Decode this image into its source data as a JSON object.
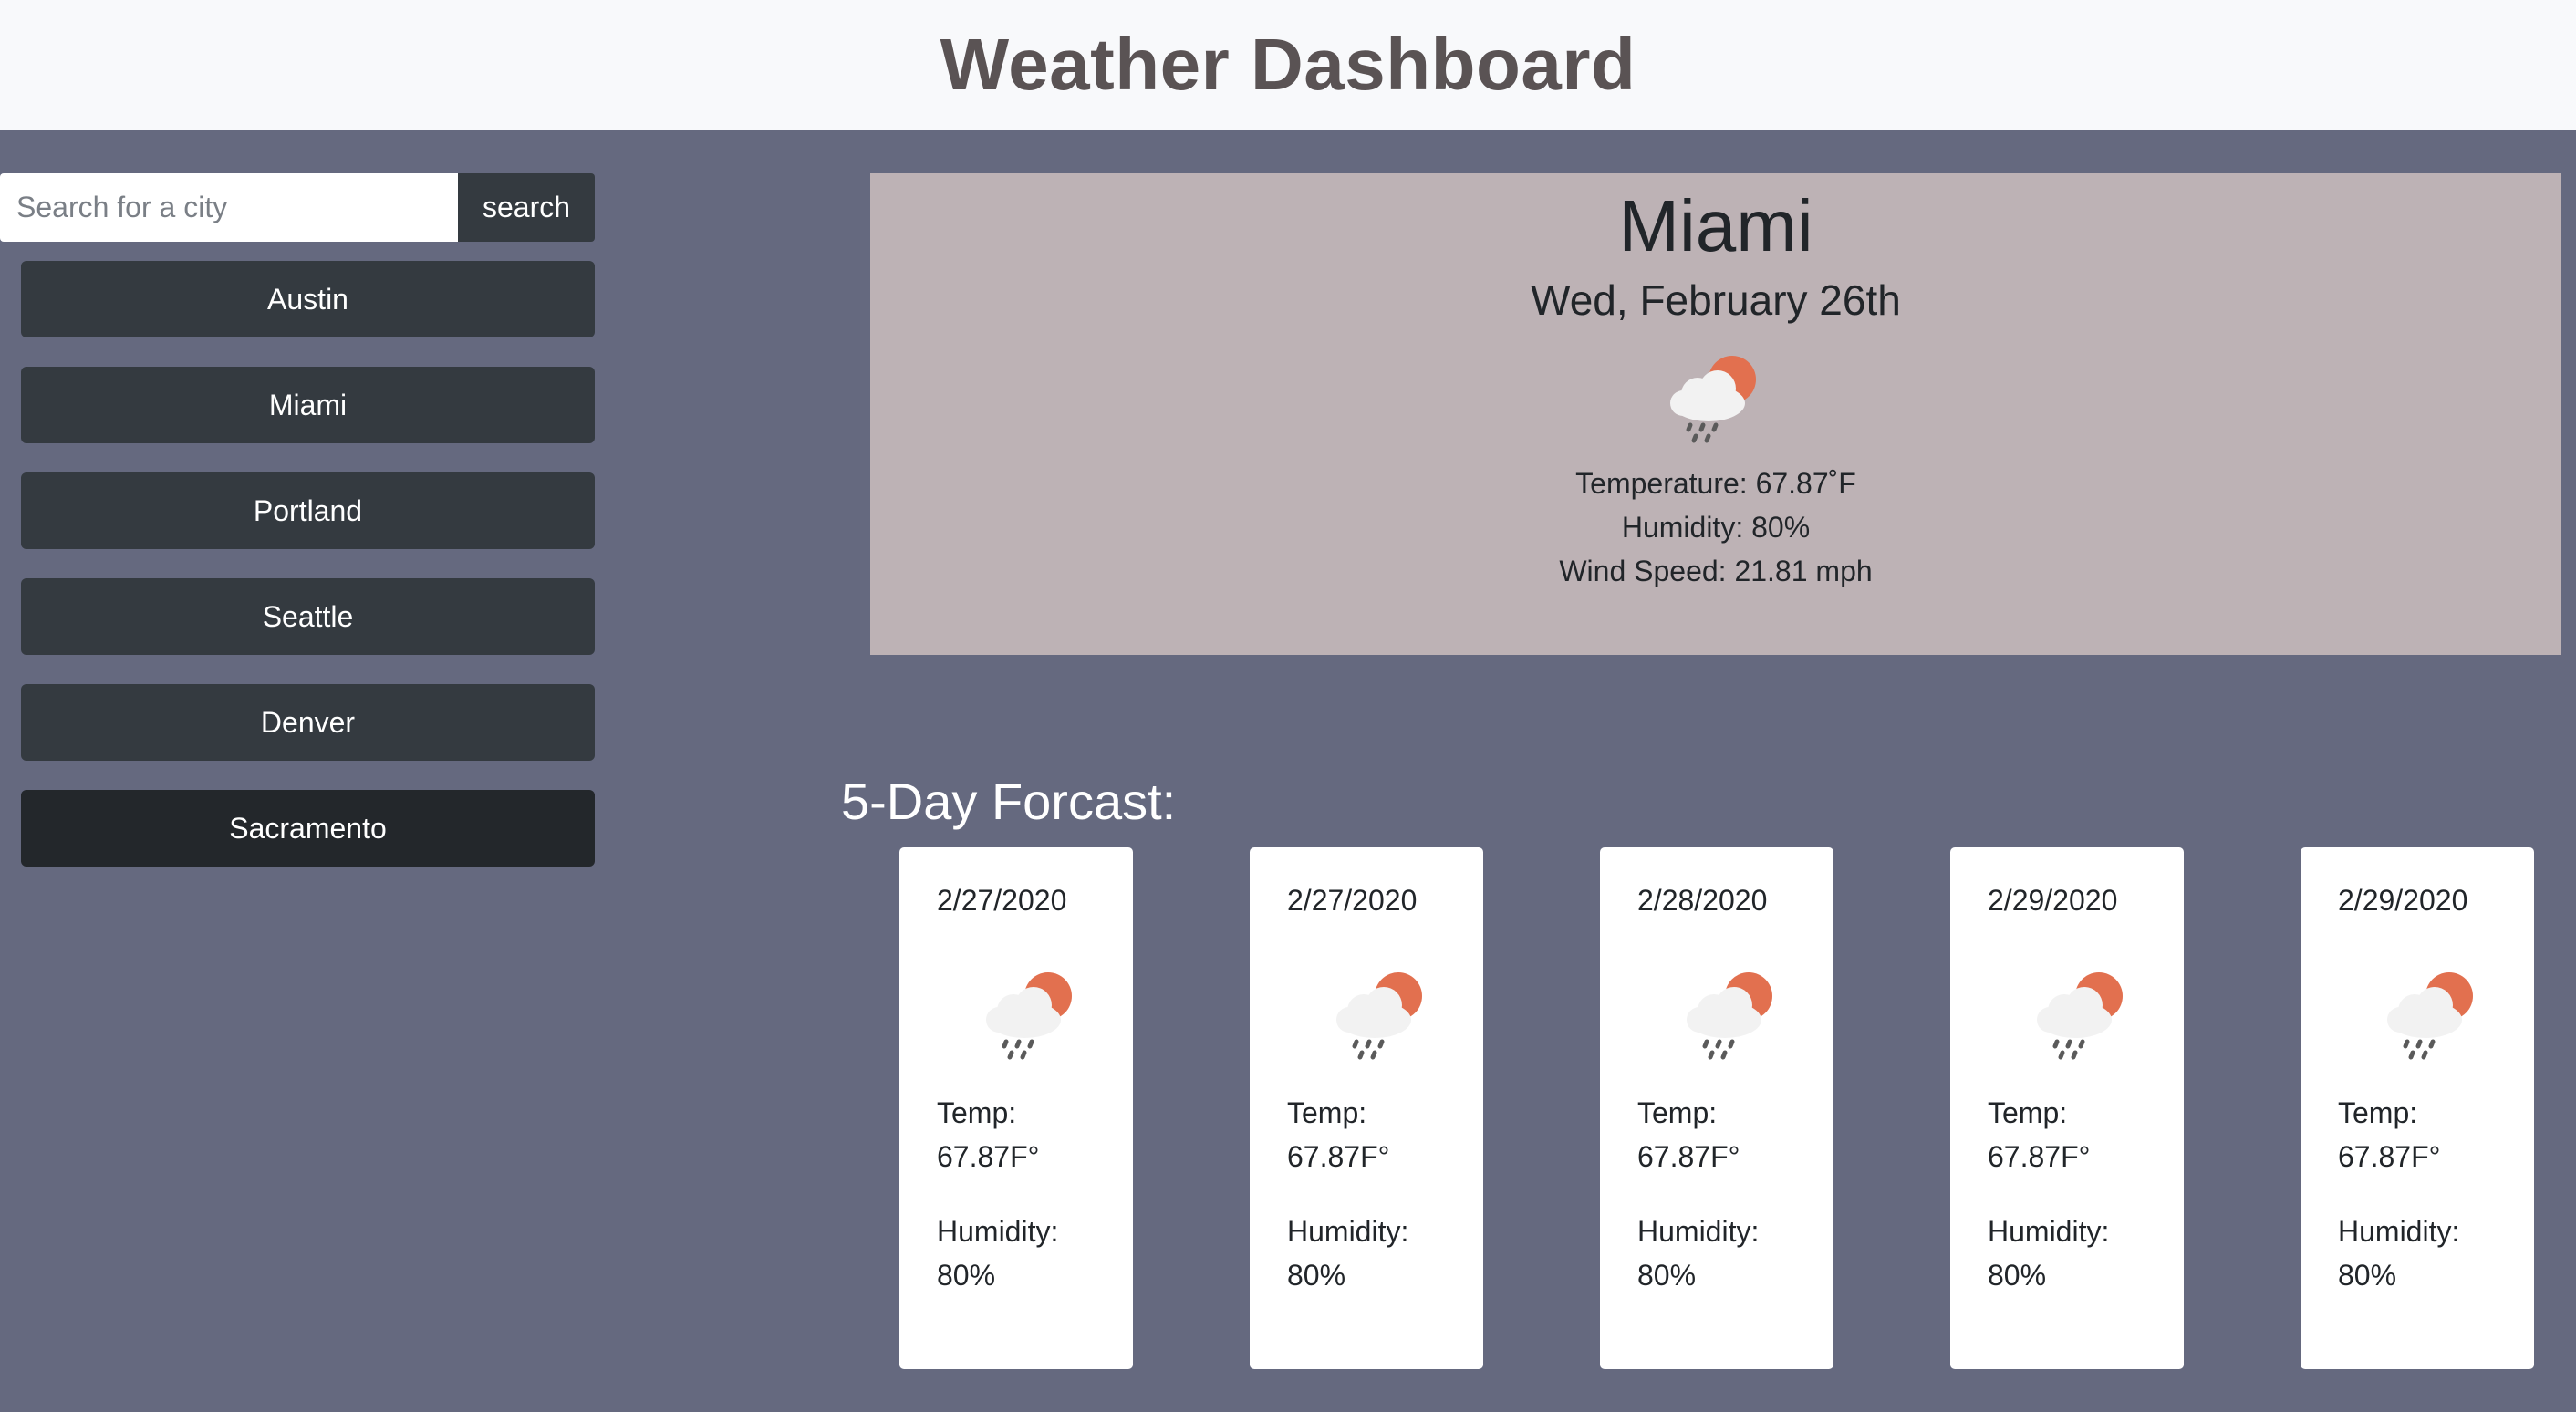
{
  "header": {
    "title": "Weather Dashboard"
  },
  "search": {
    "placeholder": "Search for a city",
    "button_label": "search"
  },
  "cities": [
    "Austin",
    "Miami",
    "Portland",
    "Seattle",
    "Denver",
    "Sacramento"
  ],
  "current": {
    "city": "Miami",
    "date": "Wed, February 26th",
    "icon": "rain-cloud-sun-icon",
    "temperature": "Temperature: 67.87˚F",
    "humidity": "Humidity: 80%",
    "wind": "Wind Speed: 21.81 mph"
  },
  "forecast": {
    "title": "5-Day Forcast:",
    "days": [
      {
        "date": "2/27/2020",
        "temp_label": "Temp:",
        "temp": "67.87F°",
        "humidity_label": "Humidity:",
        "humidity": "80%"
      },
      {
        "date": "2/27/2020",
        "temp_label": "Temp:",
        "temp": "67.87F°",
        "humidity_label": "Humidity:",
        "humidity": "80%"
      },
      {
        "date": "2/28/2020",
        "temp_label": "Temp:",
        "temp": "67.87F°",
        "humidity_label": "Humidity:",
        "humidity": "80%"
      },
      {
        "date": "2/29/2020",
        "temp_label": "Temp:",
        "temp": "67.87F°",
        "humidity_label": "Humidity:",
        "humidity": "80%"
      },
      {
        "date": "2/29/2020",
        "temp_label": "Temp:",
        "temp": "67.87F°",
        "humidity_label": "Humidity:",
        "humidity": "80%"
      }
    ]
  },
  "colors": {
    "page_bg": "#65697f",
    "header_bg": "#f8f9fb",
    "title_text": "#5a5354",
    "button_bg": "#343a40",
    "current_card_bg": "#bdb2b5",
    "sun": "#e2704f",
    "cloud": "#f2f2f2"
  }
}
